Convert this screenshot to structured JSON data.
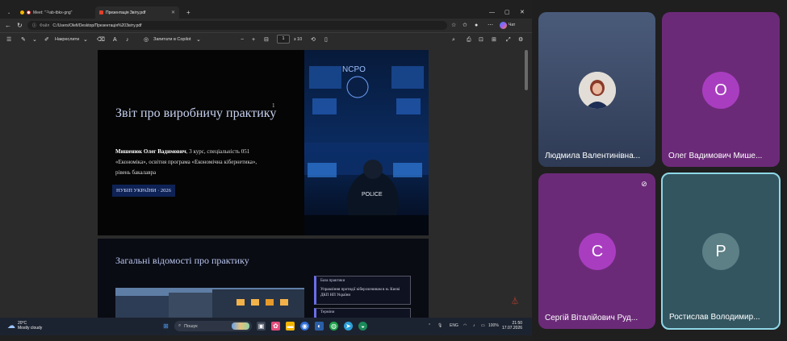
{
  "browser": {
    "tabs": [
      {
        "label": "Meet: \"ㅋab-tbkx-gng\""
      },
      {
        "label": "Презентація Звіту.pdf"
      }
    ],
    "new_tab": "+",
    "address": {
      "label": "Файл",
      "url": "C:/Users/Olefi/Desktop/Презентація%20Звіту.pdf"
    },
    "chat_label": "Чат"
  },
  "pdf_toolbar": {
    "draw_label": "Накреслити",
    "page_current": "1",
    "page_total": "з 10",
    "ask_copilot": "Запитати в Copilot"
  },
  "slide1": {
    "title": "Звіт про виробничу практику",
    "page_number": "1",
    "author": "Мишенюк Олег Вадимович",
    "details_line1": ", 3 курс, спеціальність 051",
    "details_line2": "«Економіка», освітня програма «Економічна кібернетика»,",
    "details_line3": "рівень бакалавра",
    "badge": "НУБІП УКРАЇНИ · 2026",
    "image_text_top": "NCPO",
    "image_text_police": "POLICE"
  },
  "slide2": {
    "title": "Загальні відомості про практику",
    "card_key": "База практики",
    "card_value": "Управління протидії кіберзлочинам в м. Києві ДКП НП України",
    "card2_key": "Терміни"
  },
  "taskbar": {
    "weather_temp": "20°C",
    "weather_desc": "Mostly cloudy",
    "search_placeholder": "Пошук",
    "lang": "ENG",
    "battery": "100%",
    "time": "21:50",
    "date": "17.07.2026"
  },
  "participants": [
    {
      "name": "Людмила Валентинівна...",
      "initial": "",
      "color": "#3b4a66"
    },
    {
      "name": "Олег Вадимович Мише...",
      "initial": "О",
      "color": "#6b2a78"
    },
    {
      "name": "Сергій Віталійович Руд...",
      "initial": "С",
      "color": "#6b2a78"
    },
    {
      "name": "Ростислав Володимир...",
      "initial": "Р",
      "color": "#335560"
    }
  ],
  "colors": {
    "accent_active_speaker": "#8fd8e8",
    "avatar_purple": "#a93dc0",
    "avatar_teal": "#5d7f86"
  }
}
